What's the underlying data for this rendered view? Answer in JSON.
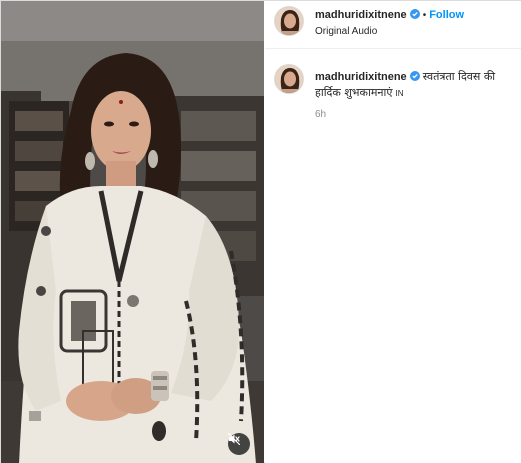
{
  "post": {
    "author": {
      "username": "madhuridixitnene",
      "verified_icon": "verified-badge-icon",
      "avatar_icon": "profile-avatar"
    },
    "header": {
      "separator": "•",
      "follow_label": "Follow",
      "audio_label": "Original Audio"
    },
    "caption": {
      "username": "madhuridixitnene",
      "text": "स्वतंत्रता दिवस की हार्दिक शुभकामनाएं",
      "suffix": "IN",
      "time": "6h"
    },
    "media": {
      "type": "video",
      "mute_icon": "speaker-muted-icon"
    },
    "colors": {
      "accent": "#0095f6",
      "verified": "#3897f0",
      "muted_text": "#8e8e8e"
    }
  }
}
